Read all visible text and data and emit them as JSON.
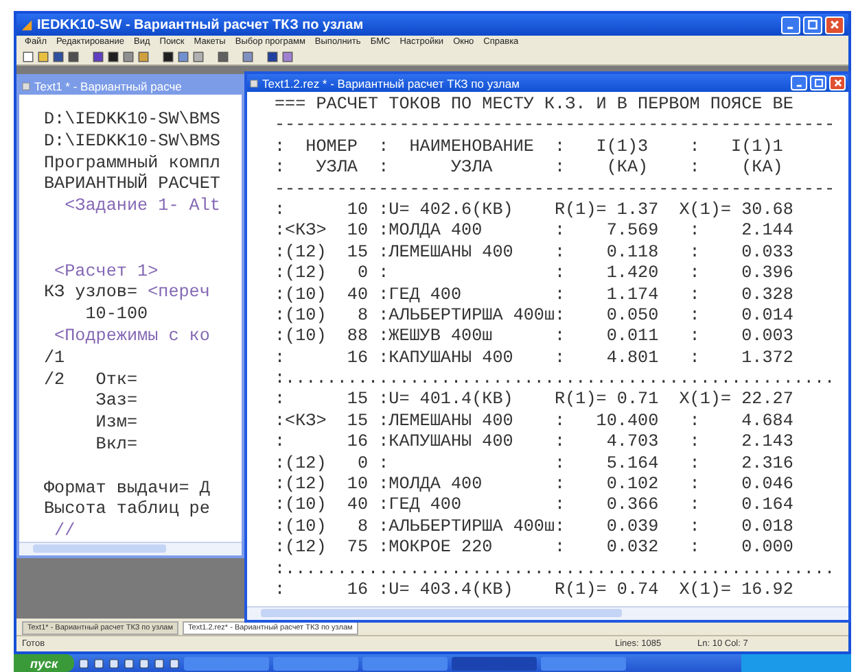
{
  "app": {
    "title": "IEDKK10-SW - Вариантный расчет ТКЗ по узлам"
  },
  "menu": [
    "Файл",
    "Редактирование",
    "Вид",
    "Поиск",
    "Макеты",
    "Выбор программ",
    "Выполнить",
    "БМС",
    "Настройки",
    "Окно",
    "Справка"
  ],
  "windows": [
    {
      "title": "Text1 * - Вариантный расче",
      "active": false,
      "lines": [
        {
          "kind": "text",
          "segments": [
            {
              "text": "D:\\IEDKK10-SW\\BMS",
              "kind": "plain"
            }
          ]
        },
        {
          "kind": "text",
          "segments": [
            {
              "text": "D:\\IEDKK10-SW\\BMS",
              "kind": "plain"
            }
          ]
        },
        {
          "kind": "text",
          "segments": [
            {
              "text": "Программный компл",
              "kind": "plain"
            }
          ]
        },
        {
          "kind": "text",
          "segments": [
            {
              "text": "ВАРИАНТНЫЙ РАСЧЕТ",
              "kind": "plain"
            }
          ]
        },
        {
          "kind": "text",
          "segments": [
            {
              "text": "  <Задание 1- Alt",
              "kind": "tag"
            }
          ]
        },
        {
          "kind": "blank"
        },
        {
          "kind": "blank"
        },
        {
          "kind": "text",
          "segments": [
            {
              "text": " <Расчет 1>",
              "kind": "tag"
            }
          ]
        },
        {
          "kind": "text",
          "segments": [
            {
              "text": "КЗ узлов= ",
              "kind": "plain"
            },
            {
              "text": "<переч",
              "kind": "tag"
            }
          ]
        },
        {
          "kind": "text",
          "segments": [
            {
              "text": "    10-100",
              "kind": "plain"
            }
          ]
        },
        {
          "kind": "text",
          "segments": [
            {
              "text": " <Подрежимы с ко",
              "kind": "tag"
            }
          ]
        },
        {
          "kind": "text",
          "segments": [
            {
              "text": "/1",
              "kind": "plain"
            }
          ]
        },
        {
          "kind": "text",
          "segments": [
            {
              "text": "/2   Отк=",
              "kind": "plain"
            }
          ]
        },
        {
          "kind": "text",
          "segments": [
            {
              "text": "     Заз=",
              "kind": "plain"
            }
          ]
        },
        {
          "kind": "text",
          "segments": [
            {
              "text": "     Изм=",
              "kind": "plain"
            }
          ]
        },
        {
          "kind": "text",
          "segments": [
            {
              "text": "     Вкл=",
              "kind": "plain"
            }
          ]
        },
        {
          "kind": "blank"
        },
        {
          "kind": "text",
          "segments": [
            {
              "text": "Формат выдачи= Д",
              "kind": "plain"
            }
          ]
        },
        {
          "kind": "text",
          "segments": [
            {
              "text": "Высота таблиц ре",
              "kind": "plain"
            }
          ]
        },
        {
          "kind": "text",
          "segments": [
            {
              "text": " //",
              "kind": "tag"
            }
          ]
        }
      ]
    },
    {
      "title": "Text1.2.rez * - Вариантный расчет ТКЗ по узлам",
      "active": true,
      "lines": [
        "=== РАСЧЕТ ТОКОВ ПО МЕСТУ К.З. И В ПЕРВОМ ПОЯСЕ ВЕ",
        "------------------------------------------------------",
        ":  НОМЕР  :  НАИМЕНОВАНИЕ  :   I(1)3    :   I(1)1",
        ":   УЗЛА  :      УЗЛА      :    (КА)    :    (КА)",
        "------------------------------------------------------",
        ":      10 :U= 402.6(КВ)    R(1)= 1.37  X(1)= 30.68",
        ":<КЗ>  10 :МОЛДА 400       :    7.569   :    2.144",
        ":(12)  15 :ЛЕМЕШАНЫ 400    :    0.118   :    0.033",
        ":(12)   0 :                :    1.420   :    0.396",
        ":(10)  40 :ГЕД 400         :    1.174   :    0.328",
        ":(10)   8 :АЛЬБЕРТИРША 400ш:    0.050   :    0.014",
        ":(10)  88 :ЖЕШУВ 400ш      :    0.011   :    0.003",
        ":      16 :КАПУШАНЫ 400    :    4.801   :    1.372",
        ":.....................................................",
        ":      15 :U= 401.4(КВ)    R(1)= 0.71  X(1)= 22.27",
        ":<КЗ>  15 :ЛЕМЕШАНЫ 400    :   10.400   :    4.684",
        ":      16 :КАПУШАНЫ 400    :    4.703   :    2.143",
        ":(12)   0 :                :    5.164   :    2.316",
        ":(12)  10 :МОЛДА 400       :    0.102   :    0.046",
        ":(10)  40 :ГЕД 400         :    0.366   :    0.164",
        ":(10)   8 :АЛЬБЕРТИРША 400ш:    0.039   :    0.018",
        ":(12)  75 :МОКРОЕ 220      :    0.032   :    0.000",
        ":.....................................................",
        ":      16 :U= 403.4(КВ)    R(1)= 0.74  X(1)= 16.92"
      ]
    }
  ],
  "tabs": [
    {
      "label": "Text1* - Вариантный расчет ТКЗ по узлам",
      "selected": false
    },
    {
      "label": "Text1.2.rez* - Вариантный расчет ТКЗ по узлам",
      "selected": true
    }
  ],
  "status_bar": {
    "state": "Готов",
    "lines": "Lines: 1085",
    "position": "Ln: 10 Col: 7"
  },
  "taskbar": {
    "start": "пуск"
  }
}
